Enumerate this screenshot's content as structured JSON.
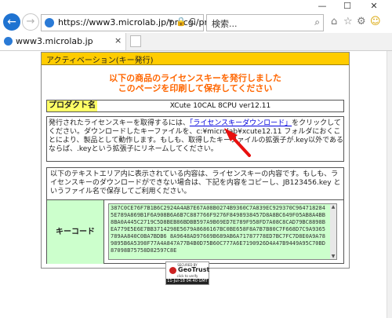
{
  "browser": {
    "window_controls": {
      "minimize": "—",
      "maximize": "☐",
      "close": "✕"
    },
    "back_glyph": "←",
    "forward_glyph": "→",
    "address": "https://www3.microlab.jp/procgi/proc",
    "address_icons": "▾ 🔒 C",
    "search_placeholder": "検索...",
    "search_glyph": "⌕",
    "toolbar": {
      "home": "⌂",
      "favorites": "☆",
      "settings": "⚙",
      "smiley": "☺"
    },
    "tab_title": "www3.microlab.jp",
    "tab_close": "×"
  },
  "page": {
    "panel_title": "アクティベーション(キー発行)",
    "heading_line1": "以下の商品のライセンスキーを発行しました",
    "heading_line2": "このページを印刷して保存してください",
    "product_label": "プロダクト名",
    "product_value": "XCute 10CAL 8CPU ver12.11",
    "instructions_before_link": "発行されたライセンスキーを取得するには、",
    "download_link": "「ライセンスキーダウンロード」",
    "instructions_after_link": "をクリックしてください。ダウンロードしたキーファイルを、c:¥microlab¥xcute12.11 フォルダにおくことにより、製品として動作します。もしも、取得したキーファイルの拡張子が.key以外であるならば、.keyという拡張子にリネームしてください。",
    "notice_text": "以下のテキストエリア内に表示されている内容は、ライセンスキーの内容です。もしも、ライセンスキーのダウンロードができない場合は、下記を内容をコピーし、JB123456.key というファイル名で保存してご利用ください。",
    "key_label": "キーコード",
    "key_code": "387C0CE76F7B1B6C2924A4AB7E67A08B0274B9360C7A839EC929370C9647182845E789A869B1F6A908B6A6B7C887766F9276F8498938457D8A8BC649F05AB8A4BB8BA0A445C2719C5D8BEB86BDBB597A9B69ED7E789F958FD7A08C8CAD79BC8898BEA779E5E6E7BB3714298E5679A8686167BC0BE658F8A7B7B80C7F668D7C9A9365789AA840C0BA7BDB6  8A9648AD97669B689AB6A71787778ED7BC7FC7D8E0A9A789895B6A5398F77A4A847A77B4B0D75B60C777A6E7190926D4A47B9449A95C70BD87098B75758D82597C8E",
    "scroll_up": "▲",
    "scroll_down": "▼",
    "badge_secured": "SECURED BY",
    "badge_brand": "GeoTrust",
    "badge_click": "click to verify",
    "badge_date": "11-Jul-18 04:40 GMT"
  },
  "colors": {
    "panel_header": "#ffcc00",
    "heading_text": "#ff6600",
    "product_label_bg": "#ffff66",
    "key_bg": "#ccffcc",
    "link": "#0000dd",
    "annotation_arrow": "#e8100f"
  }
}
